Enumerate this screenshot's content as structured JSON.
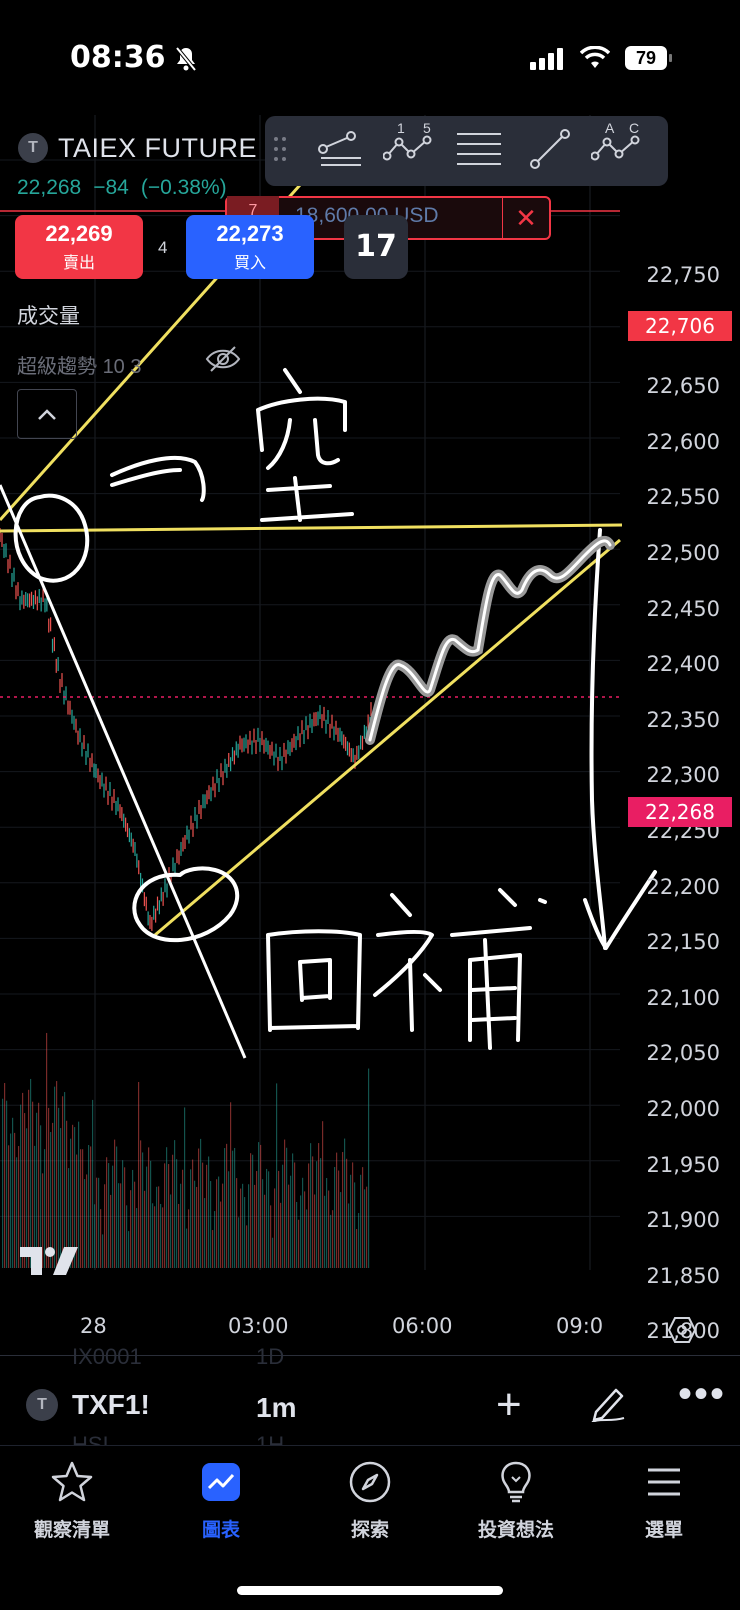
{
  "status_bar": {
    "time": "08:36",
    "battery": "79",
    "icons": [
      "silent-bell-icon",
      "cellular-signal-icon",
      "wifi-icon",
      "battery-icon"
    ]
  },
  "symbol": {
    "name": "TAIEX FUTURE",
    "last": "22,268",
    "change": "−84",
    "change_pct": "(−0.38%)"
  },
  "drawing_toolbar": {
    "icons": [
      "drag-handle-icon",
      "fib-retracement-icon",
      "elliott-wave-icon",
      "parallel-lines-icon",
      "trend-line-icon",
      "abcd-pattern-icon"
    ],
    "wave_labels": [
      "1",
      "5"
    ],
    "abc_labels": [
      "A",
      "C"
    ]
  },
  "alert": {
    "num": "7",
    "value": "18,600.00 USD",
    "close_icon": "close-icon"
  },
  "trade": {
    "sell_price": "22,269",
    "sell_label": "賣出",
    "spread": "4",
    "buy_price": "22,273",
    "buy_label": "買入",
    "badge": "17"
  },
  "indicators": {
    "volume_label": "成交量",
    "supertrend_label": "超級趨勢",
    "supertrend_params": "10 3",
    "collapse_icon": "chevron-up-icon"
  },
  "price_axis": {
    "labels": [
      "22,750",
      "22,650",
      "22,600",
      "22,550",
      "22,500",
      "22,450",
      "22,400",
      "22,350",
      "22,300",
      "22,250",
      "22,200",
      "22,150",
      "22,100",
      "22,050",
      "22,000",
      "21,950",
      "21,900",
      "21,850",
      "21,800"
    ],
    "alert_tag": "22,706",
    "current_tag": "22,268",
    "alert_color": "#f23645",
    "current_color": "#e91e63"
  },
  "time_axis": {
    "labels": [
      "28",
      "03:00",
      "06:00",
      "09:0"
    ]
  },
  "annotations": {
    "short_text": "sketch of handwritten 空",
    "cover_text": "sketch of handwritten 回補"
  },
  "bottom_toolbar": {
    "symbol": "TXF1!",
    "interval": "1m",
    "ghost_symbol_top": "IX0001",
    "ghost_interval_top": "1D",
    "ghost_symbol_bottom": "HSI",
    "ghost_interval_bottom": "1H"
  },
  "tabs": [
    {
      "label": "觀察清單",
      "icon": "star-icon"
    },
    {
      "label": "圖表",
      "icon": "chart-icon",
      "active": true
    },
    {
      "label": "探索",
      "icon": "compass-icon"
    },
    {
      "label": "投資想法",
      "icon": "lightbulb-icon"
    },
    {
      "label": "選單",
      "icon": "menu-icon"
    }
  ],
  "colors": {
    "up": "#26a69a",
    "down": "#ef5350",
    "accent": "#2962ff",
    "trendline": "#f0e060"
  }
}
